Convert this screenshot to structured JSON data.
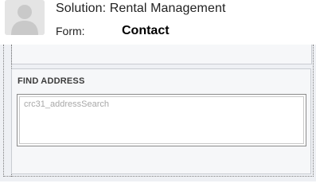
{
  "header": {
    "avatar_icon": "user-silhouette-icon",
    "solution_text": "Solution: Rental Management",
    "form_label": "Form:",
    "form_name": "Contact"
  },
  "section": {
    "title": "FIND ADDRESS",
    "field_placeholder": "crc31_addressSearch"
  },
  "colors": {
    "canvas_bg": "#eef0f4",
    "section_bg": "#f6f7f9",
    "border": "#c9ccd2"
  }
}
